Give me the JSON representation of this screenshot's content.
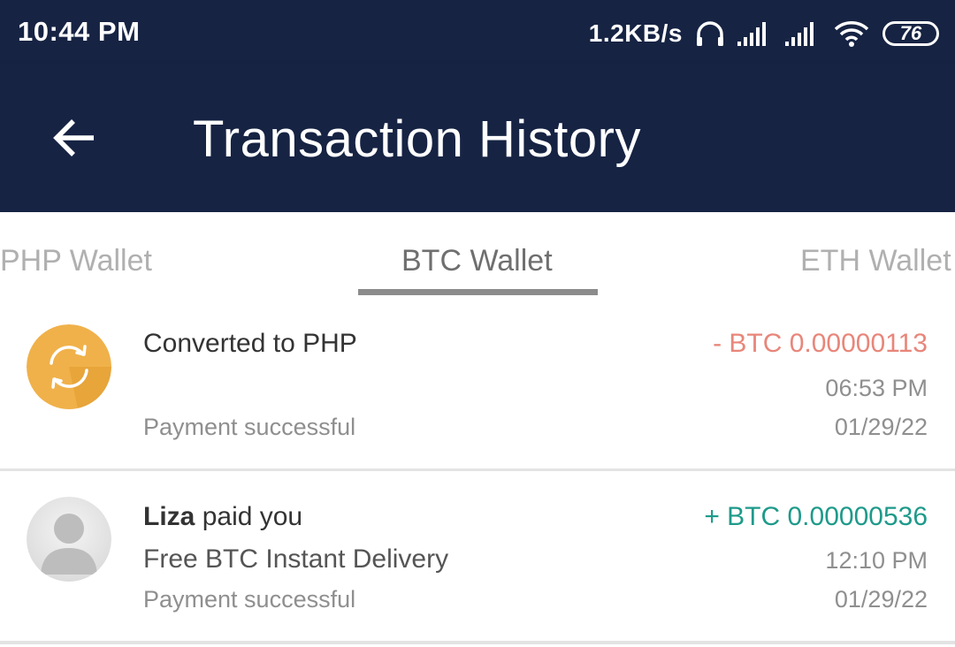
{
  "status_bar": {
    "time": "10:44 PM",
    "net_speed": "1.2KB/s",
    "battery_level": "76",
    "icons": [
      "headset-icon",
      "signal-icon",
      "signal-icon",
      "wifi-icon",
      "battery-icon"
    ]
  },
  "header": {
    "title": "Transaction History",
    "back_icon": "arrow-left-icon"
  },
  "tabs": [
    {
      "label": "PHP Wallet",
      "active": false
    },
    {
      "label": "BTC Wallet",
      "active": true
    },
    {
      "label": "ETH Wallet",
      "active": false
    }
  ],
  "transactions": [
    {
      "icon": "convert-icon",
      "title": "Converted to PHP",
      "subtitle": "",
      "status": "Payment successful",
      "amount": "- BTC 0.00000113",
      "time": "06:53 PM",
      "date": "01/29/22"
    },
    {
      "icon": "user-avatar-icon",
      "title_name": "Liza",
      "title_rest": " paid you",
      "subtitle": "Free BTC Instant Delivery",
      "status": "Payment successful",
      "amount": "+ BTC 0.00000536",
      "time": "12:10 PM",
      "date": "01/29/22"
    }
  ],
  "colors": {
    "app_bar": "#162343",
    "debit": "#e8867a",
    "credit": "#1e9a8a",
    "convert_icon_bg": "#f0b14a",
    "tab_active": "#6f6f6f",
    "tab_inactive": "#b0b0b0"
  }
}
